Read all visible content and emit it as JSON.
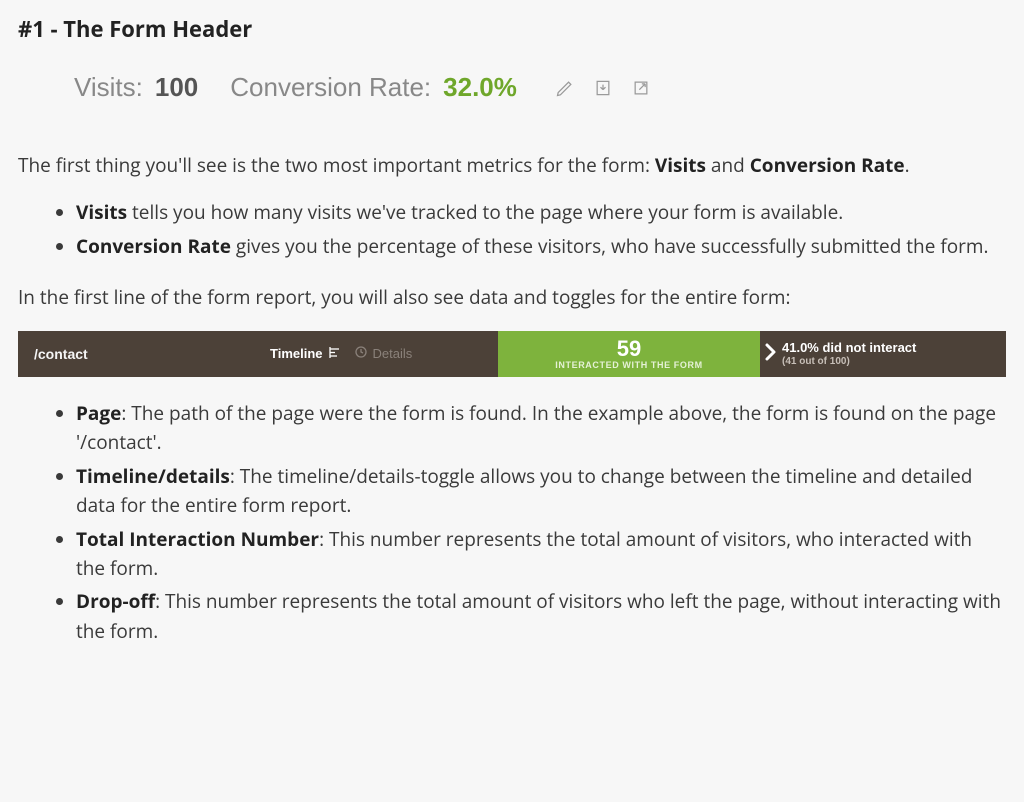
{
  "heading": "#1 - The Form Header",
  "metrics": {
    "visits_label": "Visits:",
    "visits_value": "100",
    "conv_label": "Conversion Rate:",
    "conv_value": "32.0%"
  },
  "intro_pre": "The first thing you'll see is the two most important metrics for the form: ",
  "intro_b1": "Visits",
  "intro_mid": " and ",
  "intro_b2": "Conversion Rate",
  "intro_post": ".",
  "defs1": {
    "visits_term": "Visits",
    "visits_desc": " tells you how many visits we've tracked to the page where your form is available.",
    "conv_term": "Conversion Rate",
    "conv_desc": " gives you the percentage of these visitors, who have successfully submitted the form."
  },
  "between": "In the first line of the form report, you will also see data and toggles for the entire form:",
  "report_bar": {
    "page_path": "/contact",
    "timeline_label": "Timeline",
    "details_label": "Details",
    "interacted_value": "59",
    "interacted_caption": "INTERACTED WITH THE FORM",
    "dropoff_line1": "41.0% did not interact",
    "dropoff_line2": "(41 out of 100)"
  },
  "defs2": {
    "page_term": "Page",
    "page_desc": ": The path of the page were the form is found. In the example above, the form is found on the page '/contact'.",
    "timeline_term": "Timeline/details",
    "timeline_desc": ": The timeline/details-toggle allows you to change between the timeline and detailed data for the entire form report.",
    "total_term": "Total Interaction Number",
    "total_desc": ": This number represents the total amount of visitors, who interacted with the form.",
    "drop_term": "Drop-off",
    "drop_desc": ": This number represents the total amount of visitors who left the page, without interacting with the form."
  }
}
